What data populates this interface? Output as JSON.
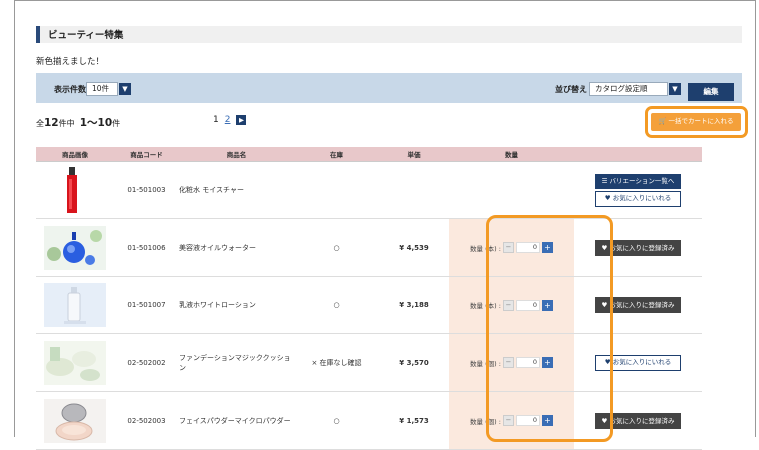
{
  "section_title": "ビューティー特集",
  "subtitle": "新色揃えました！",
  "controls": {
    "display_count_label": "表示件数",
    "display_count_value": "10件",
    "sort_label": "並び替え",
    "sort_value": "カタログ設定順",
    "edit_label": "編集"
  },
  "count": {
    "prefix": "全",
    "total": "12",
    "mid": "件中",
    "range": "1〜10",
    "suffix": "件"
  },
  "pager": {
    "current": "1",
    "page2": "2"
  },
  "cart_button": "一括でカートに入れる",
  "table": {
    "headers": [
      "商品画像",
      "商品コード",
      "商品名",
      "在庫",
      "単価",
      "数量",
      ""
    ],
    "rows": [
      {
        "code": "01-501003",
        "name": "化粧水 モイスチャー",
        "stock": "",
        "price": "",
        "qty_label": "",
        "qty": "",
        "variation": "バリエーション一覧へ",
        "action": "お気に入りにいれる",
        "action_type": "fav"
      },
      {
        "code": "01-501006",
        "name": "美容液オイルウォーター",
        "stock": "○",
        "price": "¥ 4,539",
        "qty_label": "数量 (本) :",
        "qty": "0",
        "action": "お気に入りに登録済み",
        "action_type": "reg"
      },
      {
        "code": "01-501007",
        "name": "乳液ホワイトローション",
        "stock": "○",
        "price": "¥ 3,188",
        "qty_label": "数量 (本) :",
        "qty": "0",
        "action": "お気に入りに登録済み",
        "action_type": "reg"
      },
      {
        "code": "02-502002",
        "name": "ファンデーションマジッククッション",
        "stock": "× 在庫なし確認",
        "price": "¥ 3,570",
        "qty_label": "数量 (個) :",
        "qty": "0",
        "action": "お気に入りにいれる",
        "action_type": "fav"
      },
      {
        "code": "02-502003",
        "name": "フェイスパウダーマイクロパウダー",
        "stock": "○",
        "price": "¥ 1,573",
        "qty_label": "数量 (個) :",
        "qty": "0",
        "action": "お気に入りに登録済み",
        "action_type": "reg"
      }
    ]
  },
  "colors": {
    "navy": "#1e3f6e",
    "orange": "#f39a24",
    "header_pink": "#e8c8ca",
    "qty_bg": "#fbe9de"
  }
}
